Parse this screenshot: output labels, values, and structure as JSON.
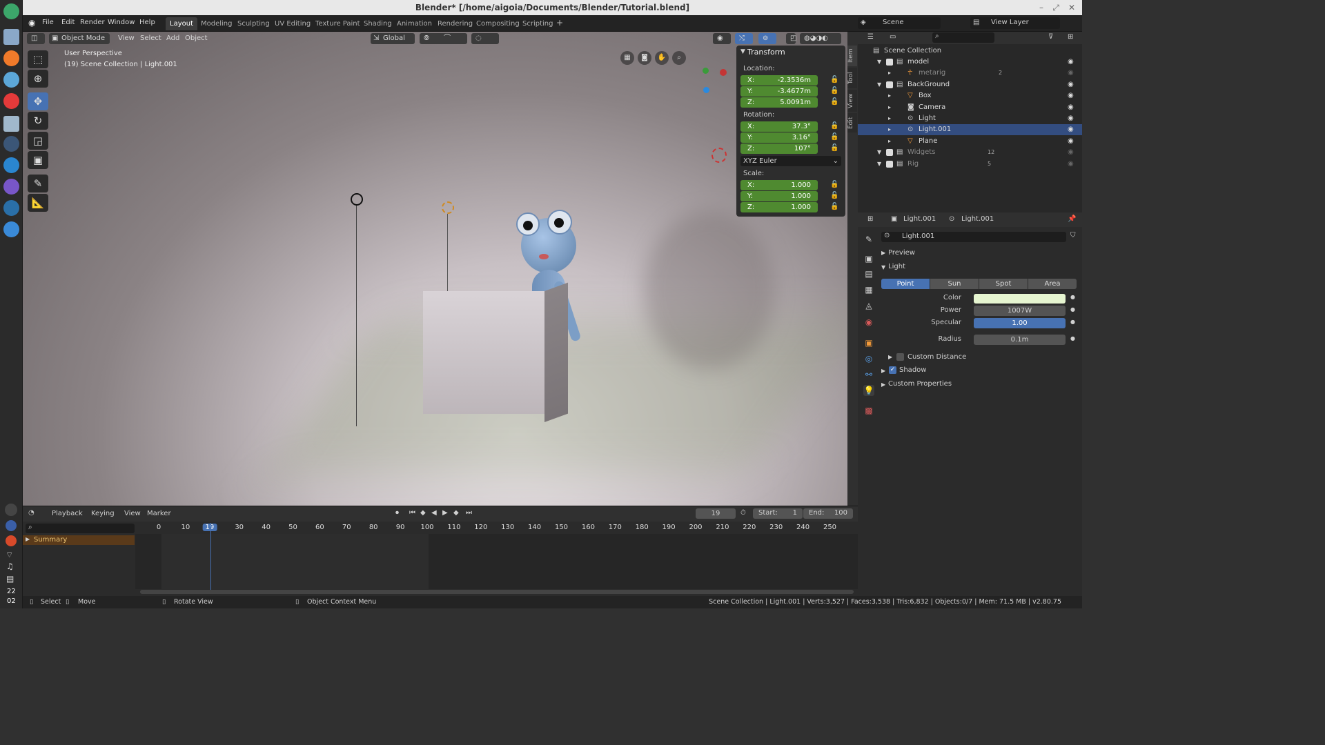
{
  "window_title": "Blender* [/home/aigoia/Documents/Blender/Tutorial.blend]",
  "dock": {
    "time_hour": "22",
    "time_min": "02"
  },
  "menu": [
    "File",
    "Edit",
    "Render",
    "Window",
    "Help"
  ],
  "workspaces": [
    "Layout",
    "Modeling",
    "Sculpting",
    "UV Editing",
    "Texture Paint",
    "Shading",
    "Animation",
    "Rendering",
    "Compositing",
    "Scripting"
  ],
  "active_workspace": "Layout",
  "scene": {
    "name": "Scene",
    "view_layer": "View Layer"
  },
  "viewport": {
    "mode": "Object Mode",
    "menus": [
      "View",
      "Select",
      "Add",
      "Object"
    ],
    "orientation": "Global",
    "overlay_title": "User Perspective",
    "overlay_sub": "(19) Scene Collection | Light.001"
  },
  "transform": {
    "title": "Transform",
    "location_label": "Location:",
    "location": [
      {
        "k": "X:",
        "v": "-2.3536m"
      },
      {
        "k": "Y:",
        "v": "-3.4677m"
      },
      {
        "k": "Z:",
        "v": "5.0091m"
      }
    ],
    "rotation_label": "Rotation:",
    "rotation": [
      {
        "k": "X:",
        "v": "37.3°"
      },
      {
        "k": "Y:",
        "v": "3.16°"
      },
      {
        "k": "Z:",
        "v": "107°"
      }
    ],
    "rotation_mode": "XYZ Euler",
    "scale_label": "Scale:",
    "scale": [
      {
        "k": "X:",
        "v": "1.000"
      },
      {
        "k": "Y:",
        "v": "1.000"
      },
      {
        "k": "Z:",
        "v": "1.000"
      }
    ]
  },
  "side_tabs": [
    "Item",
    "Tool",
    "View",
    "Edit"
  ],
  "outliner": {
    "root": "Scene Collection",
    "items": [
      {
        "name": "model",
        "indent": 1,
        "type": "collection"
      },
      {
        "name": "metarig",
        "indent": 2,
        "type": "armature",
        "dim": true,
        "badge": "2"
      },
      {
        "name": "BackGround",
        "indent": 1,
        "type": "collection"
      },
      {
        "name": "Box",
        "indent": 2,
        "type": "mesh"
      },
      {
        "name": "Camera",
        "indent": 2,
        "type": "camera"
      },
      {
        "name": "Light",
        "indent": 2,
        "type": "light"
      },
      {
        "name": "Light.001",
        "indent": 2,
        "type": "light",
        "selected": true
      },
      {
        "name": "Plane",
        "indent": 2,
        "type": "mesh"
      },
      {
        "name": "Widgets",
        "indent": 1,
        "type": "collection",
        "dim": true,
        "badge": "12"
      },
      {
        "name": "Rig",
        "indent": 1,
        "type": "collection",
        "dim": true,
        "badge": "5"
      }
    ]
  },
  "properties": {
    "object_name": "Light.001",
    "data_name": "Light.001",
    "datablock": "Light.001",
    "sections": {
      "preview": "Preview",
      "light": "Light",
      "custom_distance": "Custom Distance",
      "shadow": "Shadow",
      "custom_props": "Custom Properties"
    },
    "light_types": [
      "Point",
      "Sun",
      "Spot",
      "Area"
    ],
    "active_type": "Point",
    "color_label": "Color",
    "color": "#e6f5d0",
    "power_label": "Power",
    "power": "1007W",
    "specular_label": "Specular",
    "specular": "1.00",
    "radius_label": "Radius",
    "radius": "0.1m"
  },
  "timeline": {
    "menus": [
      "Playback",
      "Keying",
      "View",
      "Marker"
    ],
    "current_frame": "19",
    "start_label": "Start:",
    "start": "1",
    "end_label": "End:",
    "end": "100",
    "ticks": [
      "0",
      "10",
      "19",
      "30",
      "40",
      "50",
      "60",
      "70",
      "80",
      "90",
      "100",
      "110",
      "120",
      "130",
      "140",
      "150",
      "160",
      "170",
      "180",
      "190",
      "200",
      "210",
      "220",
      "230",
      "240",
      "250"
    ],
    "summary": "Summary"
  },
  "status": {
    "left": [
      "Select",
      "Move",
      "Rotate View",
      "Object Context Menu"
    ],
    "right": "Scene Collection | Light.001 | Verts:3,527 | Faces:3,538 | Tris:6,832 | Objects:0/7 | Mem: 71.5 MB | v2.80.75"
  }
}
